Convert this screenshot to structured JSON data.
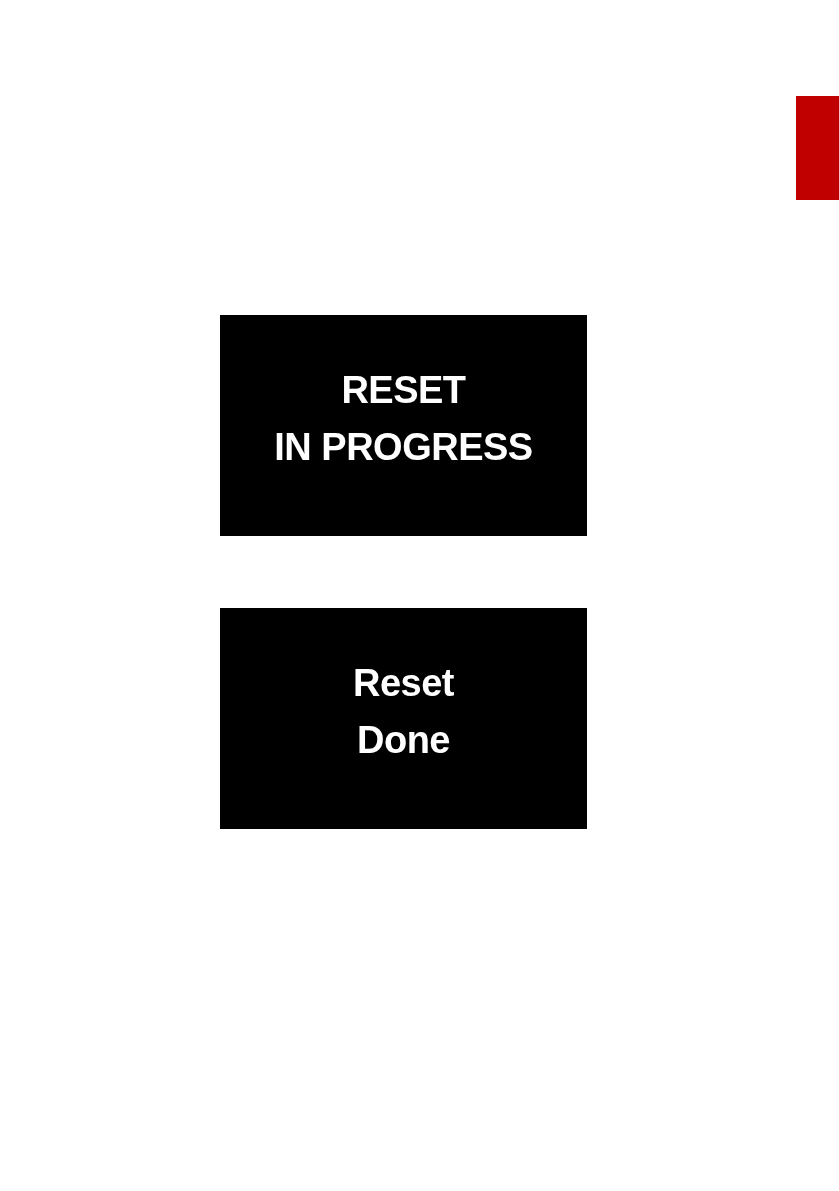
{
  "screens": [
    {
      "lines": [
        "RESET",
        "IN PROGRESS"
      ]
    },
    {
      "lines": [
        "Reset",
        "Done"
      ]
    }
  ]
}
